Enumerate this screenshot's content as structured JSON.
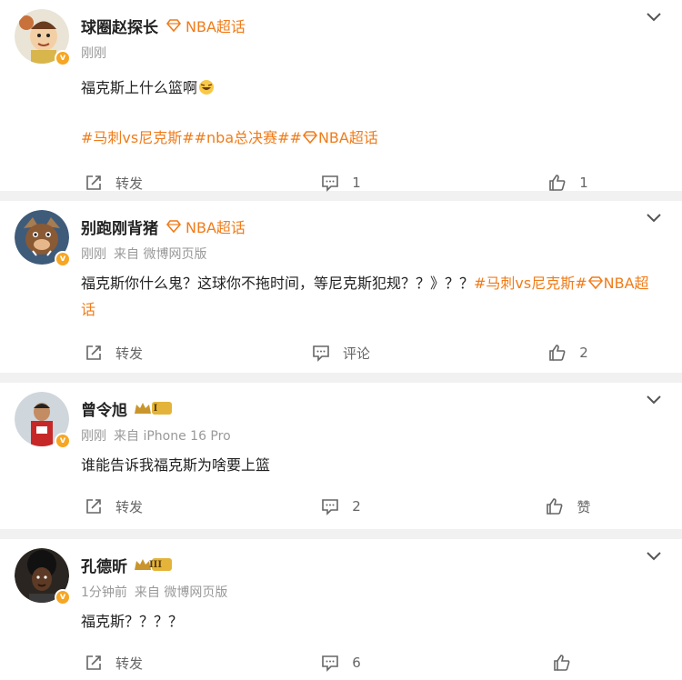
{
  "posts": [
    {
      "author": "球圈赵探长",
      "super_topic": "NBA超话",
      "time": "刚刚",
      "source": "",
      "text": "福克斯上什么篮啊",
      "hashtags": [
        "#马刺vs尼克斯#",
        "#nba总决赛#",
        "#",
        "NBA超话"
      ],
      "repost_label": "转发",
      "comment_label": "1",
      "like_label": "1"
    },
    {
      "author": "别跑刚背猪",
      "super_topic": "NBA超话",
      "time": "刚刚",
      "source": "来自 微博网页版",
      "text": "福克斯你什么鬼？这球你不拖时间，等尼克斯犯规？？》？？",
      "hashtags": [
        "#马刺vs尼克斯#",
        "NBA超话"
      ],
      "repost_label": "转发",
      "comment_label": "评论",
      "like_label": "2"
    },
    {
      "author": "曾令旭",
      "rank_badge": "I",
      "time": "刚刚",
      "source": "来自 iPhone 16 Pro",
      "text": "谁能告诉我福克斯为啥要上篮",
      "repost_label": "转发",
      "comment_label": "2",
      "like_label": "赞"
    },
    {
      "author": "孔德昕",
      "rank_badge": "III",
      "time": "1分钟前",
      "source": "来自 微博网页版",
      "text": "福克斯？？？？",
      "repost_label": "转发",
      "comment_label": "6",
      "like_label": ""
    }
  ],
  "colors": {
    "accent": "#f07c1a",
    "verified": "#f6a623",
    "meta": "#999999"
  },
  "icons": [
    "chevron-down-icon",
    "diamond-icon",
    "repost-icon",
    "comment-icon",
    "like-icon",
    "laugh-emoji-icon"
  ]
}
